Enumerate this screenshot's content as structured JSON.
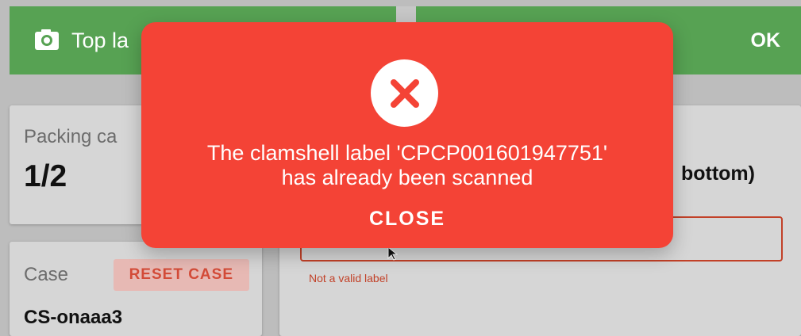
{
  "topbar": {
    "left_label": "Top la",
    "right_status": "OK",
    "left_icon": "camera-icon"
  },
  "sidebar": {
    "packing_title": "Packing ca",
    "packing_count": "1/2",
    "case_title": "Case",
    "reset_label": "RESET CASE",
    "case_id": "CS-onaaa3"
  },
  "main": {
    "bottom_text": "bottom)",
    "input_value": "",
    "input_placeholder": "",
    "error_text": "Not a valid label"
  },
  "modal": {
    "icon": "error-x-icon",
    "message_line1": "The clamshell label 'CPCP001601947751'",
    "message_line2": "has already been scanned",
    "close_label": "CLOSE"
  },
  "colors": {
    "topbar_green": "#57a253",
    "modal_red": "#f44336",
    "error_red": "#c24128"
  }
}
